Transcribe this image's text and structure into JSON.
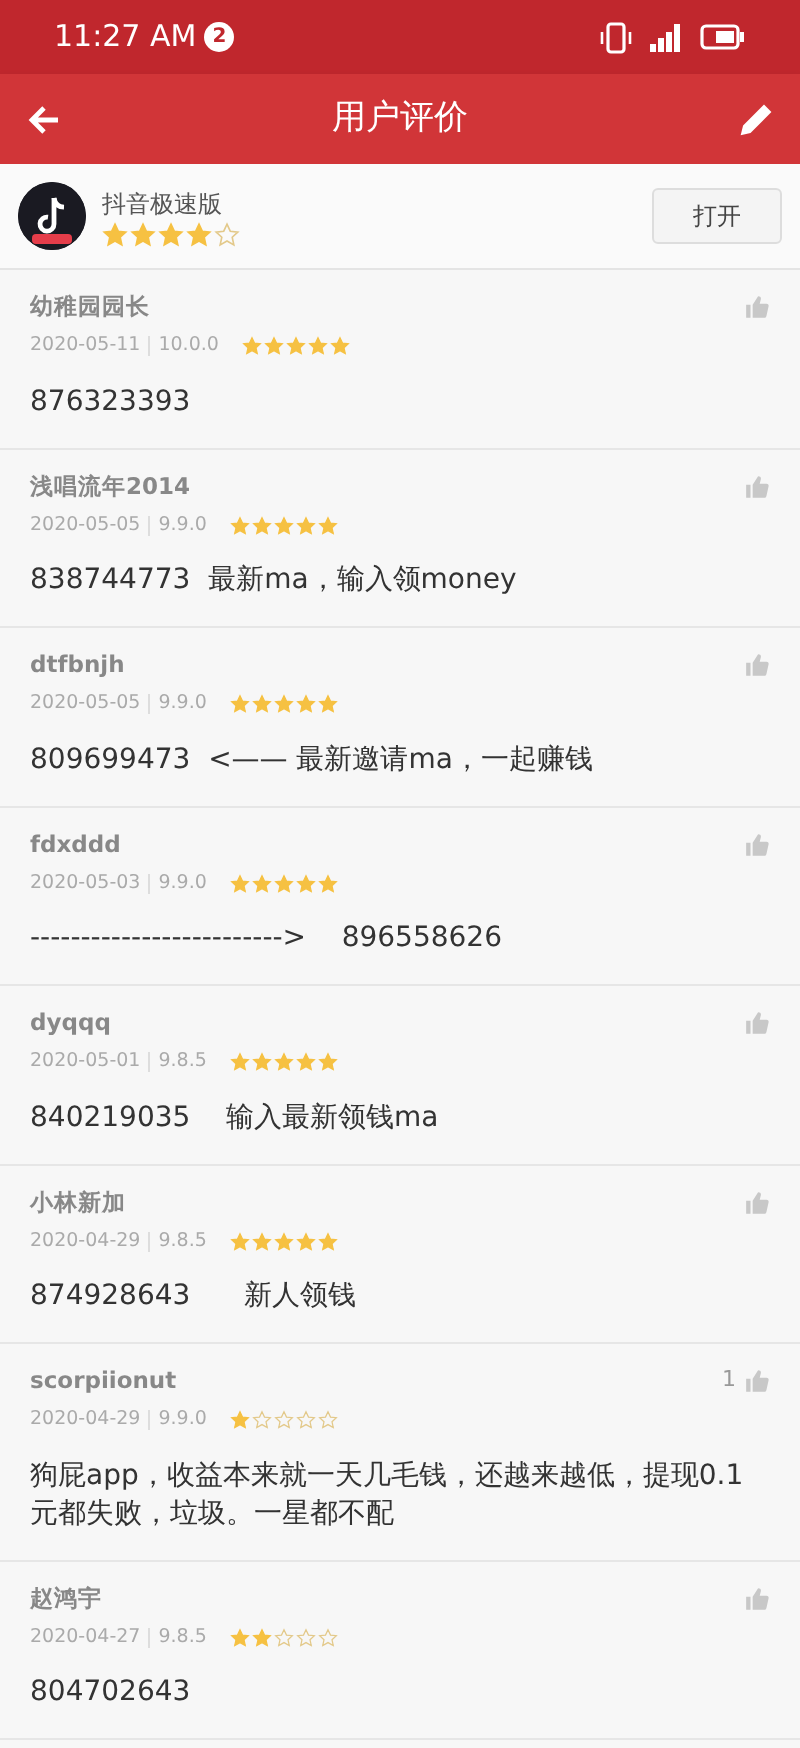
{
  "status_bar": {
    "time": "11:27 AM",
    "notification_count": "2"
  },
  "app_bar": {
    "title": "用户评价"
  },
  "app": {
    "name": "抖音极速版",
    "stars": 4,
    "open_button": "打开"
  },
  "reviews": [
    {
      "user": "幼稚园园长",
      "date": "2020-05-11",
      "version": "10.0.0",
      "stars": 5,
      "text": "876323393"
    },
    {
      "user": "浅唱流年2014",
      "date": "2020-05-05",
      "version": "9.9.0",
      "stars": 5,
      "text": "838744773  最新ma，输入领money"
    },
    {
      "user": "dtfbnjh",
      "date": "2020-05-05",
      "version": "9.9.0",
      "stars": 5,
      "text": "809699473  <—— 最新邀请ma，一起赚钱"
    },
    {
      "user": "fdxddd",
      "date": "2020-05-03",
      "version": "9.9.0",
      "stars": 5,
      "text": "------------------------->    896558626"
    },
    {
      "user": "dyqqq",
      "date": "2020-05-01",
      "version": "9.8.5",
      "stars": 5,
      "text": "840219035    输入最新领钱ma"
    },
    {
      "user": "小林新加",
      "date": "2020-04-29",
      "version": "9.8.5",
      "stars": 5,
      "text": "874928643      新人领钱"
    },
    {
      "user": "scorpiionut",
      "date": "2020-04-29",
      "version": "9.9.0",
      "stars": 1,
      "likes": "1",
      "text": "狗屁app，收益本来就一天几毛钱，还越来越低，提现0.1元都失败，垃圾。一星都不配"
    },
    {
      "user": "赵鸿宇",
      "date": "2020-04-27",
      "version": "9.8.5",
      "stars": 2,
      "text": "804702643"
    }
  ]
}
